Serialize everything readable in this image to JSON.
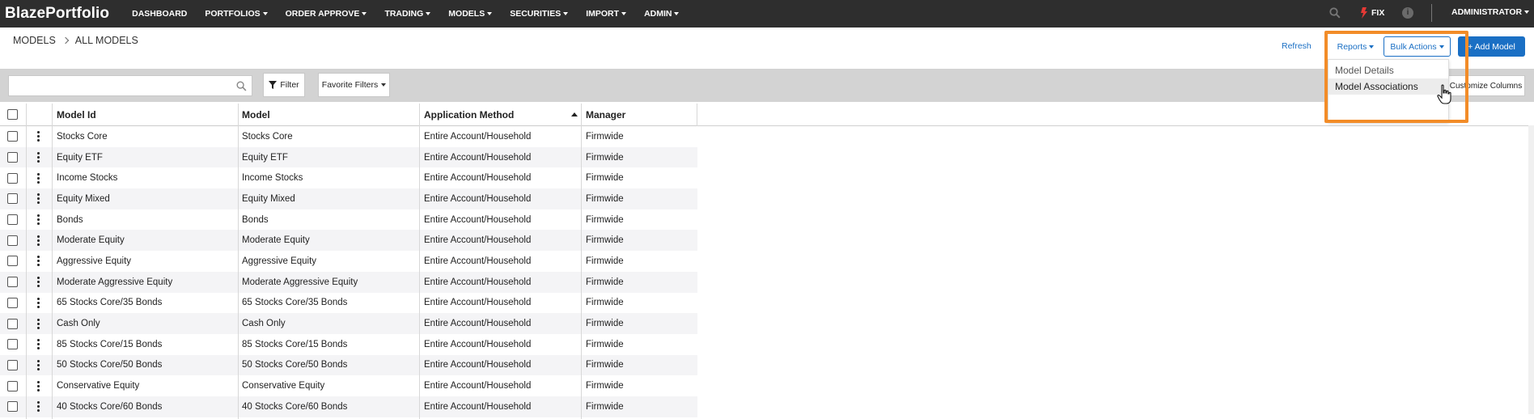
{
  "app": {
    "brand": "BlazePortfolio"
  },
  "nav": {
    "items": [
      {
        "label": "DASHBOARD",
        "dropdown": false
      },
      {
        "label": "PORTFOLIOS",
        "dropdown": true
      },
      {
        "label": "ORDER APPROVE",
        "dropdown": true
      },
      {
        "label": "TRADING",
        "dropdown": true
      },
      {
        "label": "MODELS",
        "dropdown": true
      },
      {
        "label": "SECURITIES",
        "dropdown": true
      },
      {
        "label": "IMPORT",
        "dropdown": true
      },
      {
        "label": "ADMIN",
        "dropdown": true
      }
    ],
    "fix_label": "FIX",
    "info_glyph": "i",
    "user_label": "ADMINISTRATOR"
  },
  "breadcrumb": {
    "root": "MODELS",
    "current": "ALL MODELS"
  },
  "actions": {
    "refresh": "Refresh",
    "reports": "Reports",
    "bulk_actions": "Bulk Actions",
    "add_model": "+ Add Model"
  },
  "toolbar": {
    "search_value": "",
    "filter": "Filter",
    "favorite_filters": "Favorite Filters",
    "customize_columns": "Customize Columns"
  },
  "reports_menu": {
    "items": [
      "Model Details",
      "Model Associations"
    ],
    "hovered": "Model Associations"
  },
  "table": {
    "columns": [
      "Model Id",
      "Model",
      "Application Method",
      "Manager"
    ],
    "sorted_column": "Application Method",
    "sort_direction": "ascending",
    "rows": [
      [
        "Stocks Core",
        "Stocks Core",
        "Entire Account/Household",
        "Firmwide"
      ],
      [
        "Equity ETF",
        "Equity ETF",
        "Entire Account/Household",
        "Firmwide"
      ],
      [
        "Income Stocks",
        "Income Stocks",
        "Entire Account/Household",
        "Firmwide"
      ],
      [
        "Equity Mixed",
        "Equity Mixed",
        "Entire Account/Household",
        "Firmwide"
      ],
      [
        "Bonds",
        "Bonds",
        "Entire Account/Household",
        "Firmwide"
      ],
      [
        "Moderate Equity",
        "Moderate Equity",
        "Entire Account/Household",
        "Firmwide"
      ],
      [
        "Aggressive Equity",
        "Aggressive Equity",
        "Entire Account/Household",
        "Firmwide"
      ],
      [
        "Moderate Aggressive Equity",
        "Moderate Aggressive Equity",
        "Entire Account/Household",
        "Firmwide"
      ],
      [
        "65 Stocks Core/35 Bonds",
        "65 Stocks Core/35 Bonds",
        "Entire Account/Household",
        "Firmwide"
      ],
      [
        "Cash Only",
        "Cash Only",
        "Entire Account/Household",
        "Firmwide"
      ],
      [
        "85 Stocks Core/15 Bonds",
        "85 Stocks Core/15 Bonds",
        "Entire Account/Household",
        "Firmwide"
      ],
      [
        "50 Stocks Core/50 Bonds",
        "50 Stocks Core/50 Bonds",
        "Entire Account/Household",
        "Firmwide"
      ],
      [
        "Conservative Equity",
        "Conservative Equity",
        "Entire Account/Household",
        "Firmwide"
      ],
      [
        "40 Stocks Core/60 Bonds",
        "40 Stocks Core/60 Bonds",
        "Entire Account/Household",
        "Firmwide"
      ]
    ]
  },
  "colors": {
    "nav_bg": "#2e2e2e",
    "accent": "#1a6fc4",
    "fix_icon": "#e53935",
    "toolbar_bg": "#d3d3d3",
    "highlight": "#f28c28",
    "alt_row": "#f4f4f6"
  }
}
